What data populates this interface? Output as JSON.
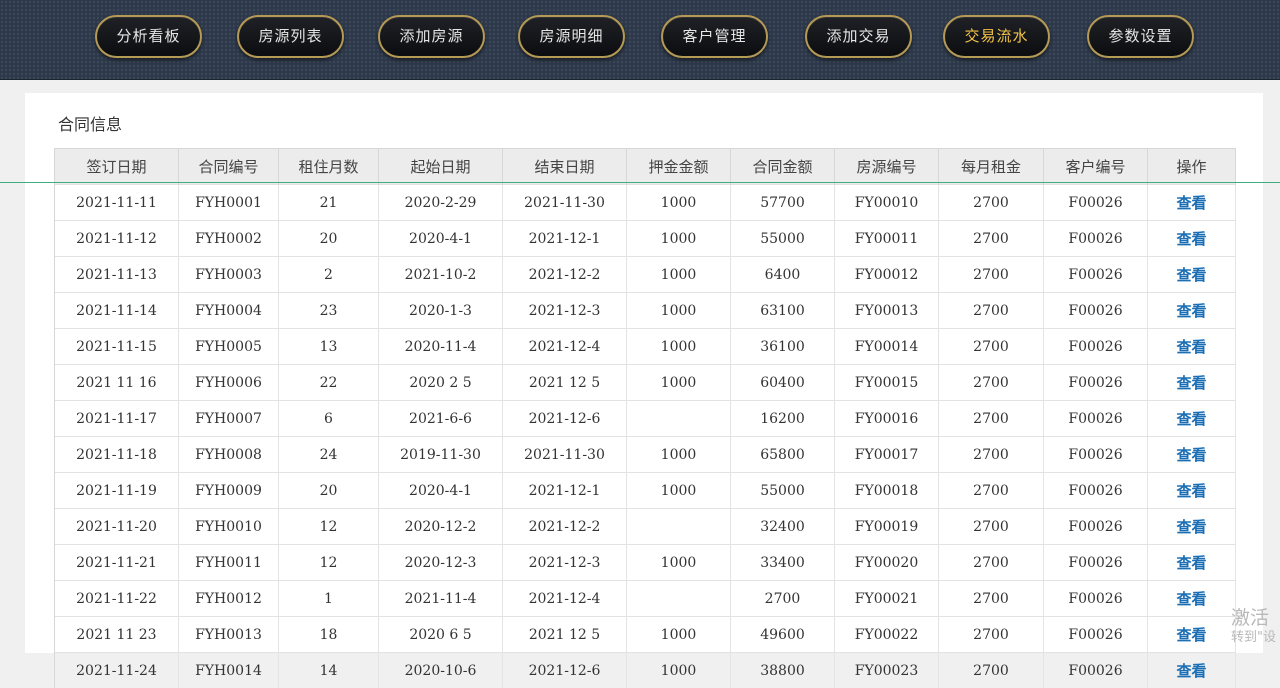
{
  "nav": {
    "items": [
      {
        "label": "分析看板"
      },
      {
        "label": "房源列表"
      },
      {
        "label": "添加房源"
      },
      {
        "label": "房源明细"
      },
      {
        "label": "客户管理"
      },
      {
        "label": "添加交易"
      },
      {
        "label": "交易流水"
      },
      {
        "label": "参数设置"
      }
    ],
    "active_index": 6,
    "active_color": "#f4c44a"
  },
  "panel": {
    "title": "合同信息"
  },
  "table": {
    "headers": [
      "签订日期",
      "合同编号",
      "租住月数",
      "起始日期",
      "结束日期",
      "押金金额",
      "合同金额",
      "房源编号",
      "每月租金",
      "客户编号",
      "操作"
    ],
    "rows": [
      [
        "2021-11-11",
        "FYH0001",
        "21",
        "2020-2-29",
        "2021-11-30",
        "1000",
        "57700",
        "FY00010",
        "2700",
        "F00026",
        "查看"
      ],
      [
        "2021-11-12",
        "FYH0002",
        "20",
        "2020-4-1",
        "2021-12-1",
        "1000",
        "55000",
        "FY00011",
        "2700",
        "F00026",
        "查看"
      ],
      [
        "2021-11-13",
        "FYH0003",
        "2",
        "2021-10-2",
        "2021-12-2",
        "1000",
        "6400",
        "FY00012",
        "2700",
        "F00026",
        "查看"
      ],
      [
        "2021-11-14",
        "FYH0004",
        "23",
        "2020-1-3",
        "2021-12-3",
        "1000",
        "63100",
        "FY00013",
        "2700",
        "F00026",
        "查看"
      ],
      [
        "2021-11-15",
        "FYH0005",
        "13",
        "2020-11-4",
        "2021-12-4",
        "1000",
        "36100",
        "FY00014",
        "2700",
        "F00026",
        "查看"
      ],
      [
        "2021 11 16",
        "FYH0006",
        "22",
        "2020 2 5",
        "2021 12 5",
        "1000",
        "60400",
        "FY00015",
        "2700",
        "F00026",
        "查看"
      ],
      [
        "2021-11-17",
        "FYH0007",
        "6",
        "2021-6-6",
        "2021-12-6",
        "",
        "16200",
        "FY00016",
        "2700",
        "F00026",
        "查看"
      ],
      [
        "2021-11-18",
        "FYH0008",
        "24",
        "2019-11-30",
        "2021-11-30",
        "1000",
        "65800",
        "FY00017",
        "2700",
        "F00026",
        "查看"
      ],
      [
        "2021-11-19",
        "FYH0009",
        "20",
        "2020-4-1",
        "2021-12-1",
        "1000",
        "55000",
        "FY00018",
        "2700",
        "F00026",
        "查看"
      ],
      [
        "2021-11-20",
        "FYH0010",
        "12",
        "2020-12-2",
        "2021-12-2",
        "",
        "32400",
        "FY00019",
        "2700",
        "F00026",
        "查看"
      ],
      [
        "2021-11-21",
        "FYH0011",
        "12",
        "2020-12-3",
        "2021-12-3",
        "1000",
        "33400",
        "FY00020",
        "2700",
        "F00026",
        "查看"
      ],
      [
        "2021-11-22",
        "FYH0012",
        "1",
        "2021-11-4",
        "2021-12-4",
        "",
        "2700",
        "FY00021",
        "2700",
        "F00026",
        "查看"
      ],
      [
        "2021 11 23",
        "FYH0013",
        "18",
        "2020 6 5",
        "2021 12 5",
        "1000",
        "49600",
        "FY00022",
        "2700",
        "F00026",
        "查看"
      ],
      [
        "2021-11-24",
        "FYH0014",
        "14",
        "2020-10-6",
        "2021-12-6",
        "1000",
        "38800",
        "FY00023",
        "2700",
        "F00026",
        "查看"
      ]
    ]
  },
  "watermark": {
    "line1": "激活",
    "line2": "转到\"设"
  }
}
